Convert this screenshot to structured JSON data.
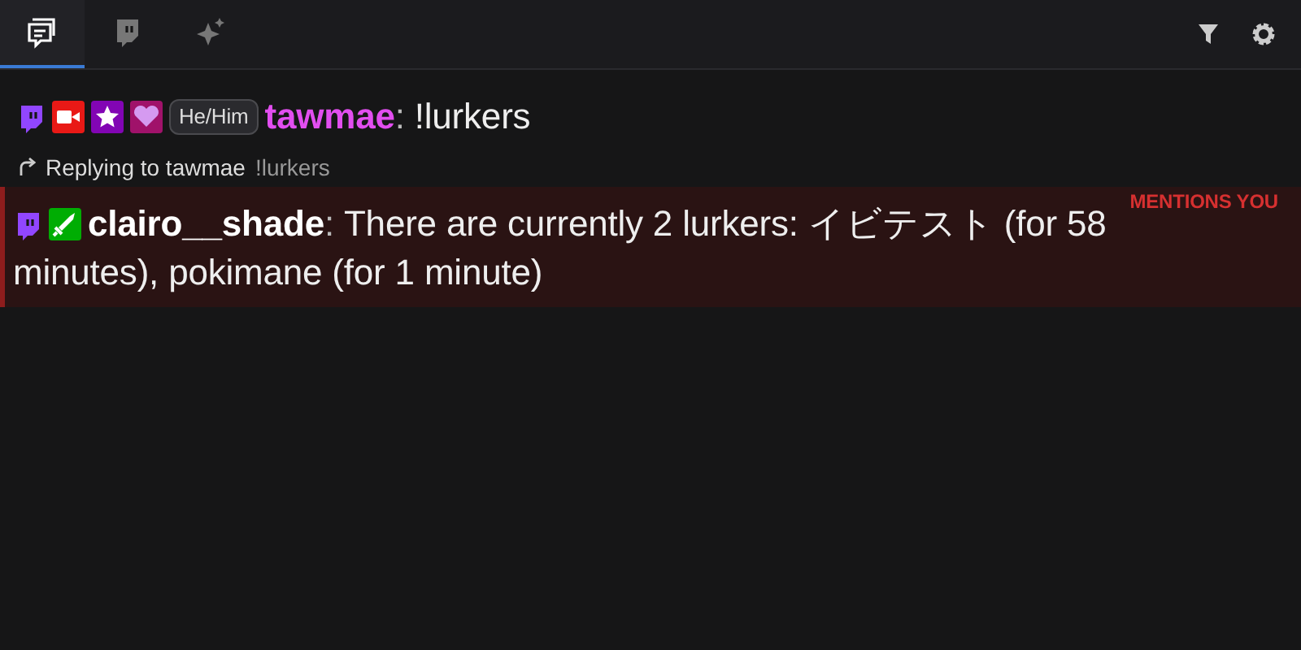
{
  "tabs": [
    {
      "kind": "chat",
      "selected": true
    },
    {
      "kind": "platform",
      "selected": false
    },
    {
      "kind": "sparkle",
      "selected": false
    }
  ],
  "toolbar": [
    {
      "kind": "filter"
    },
    {
      "kind": "settings"
    }
  ],
  "messages": [
    {
      "badges": [
        {
          "kind": "platform"
        },
        {
          "kind": "camera"
        },
        {
          "kind": "star"
        },
        {
          "kind": "heart"
        },
        {
          "kind": "pronoun",
          "text": "He/Him"
        }
      ],
      "username": "tawmae",
      "color": "#e24ef0",
      "separator": ":",
      "text": "!lurkers",
      "mention": false
    },
    {
      "reply": {
        "prefix": "Replying to tawmae",
        "quote": "!lurkers"
      },
      "badges": [
        {
          "kind": "platform"
        },
        {
          "kind": "sword"
        }
      ],
      "username": "clairo__shade",
      "color": "#ffffff",
      "separator": ":",
      "text": "There are currently 2 lurkers: イビテスト (for 58",
      "text_continued": "minutes), pokimane (for 1 minute)",
      "mention": true,
      "mention_label": "MENTIONS YOU"
    }
  ]
}
